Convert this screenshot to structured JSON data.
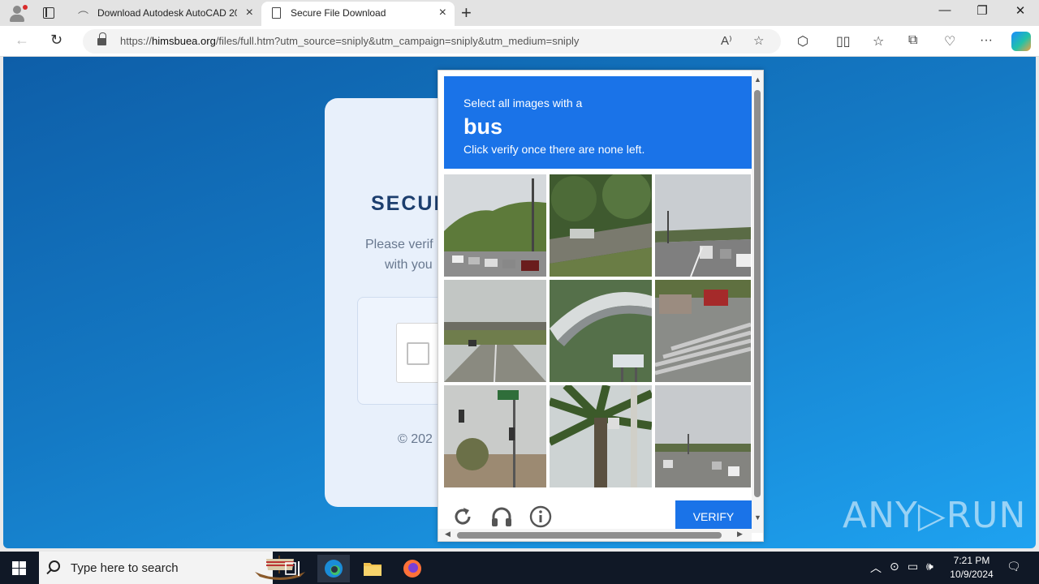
{
  "browser": {
    "tabs": [
      {
        "label": "Download Autodesk AutoCAD 20",
        "active": false
      },
      {
        "label": "Secure File Download",
        "active": true
      }
    ],
    "url": {
      "prefix": "https://",
      "domain": "himsbuea.org",
      "path": "/files/full.htm?utm_source=sniply&utm_campaign=sniply&utm_medium=sniply"
    }
  },
  "page": {
    "title": "SECUR",
    "subtitle_line1": "Please verif",
    "subtitle_line2": "with you",
    "copyright": "© 202"
  },
  "captcha": {
    "instruction": "Select all images with a",
    "target": "bus",
    "hint": "Click verify once there are none left.",
    "verify_label": "VERIFY",
    "tiles": [
      {
        "name": "tile-street-hill-traffic"
      },
      {
        "name": "tile-overgrown-road"
      },
      {
        "name": "tile-highway-lanes"
      },
      {
        "name": "tile-overpass-road"
      },
      {
        "name": "tile-curved-bridge"
      },
      {
        "name": "tile-crosswalk-cars"
      },
      {
        "name": "tile-traffic-light-sign"
      },
      {
        "name": "tile-palm-tree"
      },
      {
        "name": "tile-wide-road"
      }
    ]
  },
  "watermark": "ANY RUN",
  "taskbar": {
    "search_placeholder": "Type here to search",
    "time": "7:21 PM",
    "date": "10/9/2024"
  },
  "colors": {
    "accent": "#1a73e8",
    "page_gradient_start": "#0e5ea8",
    "page_gradient_end": "#1ea2f0",
    "taskbar": "#101826"
  }
}
